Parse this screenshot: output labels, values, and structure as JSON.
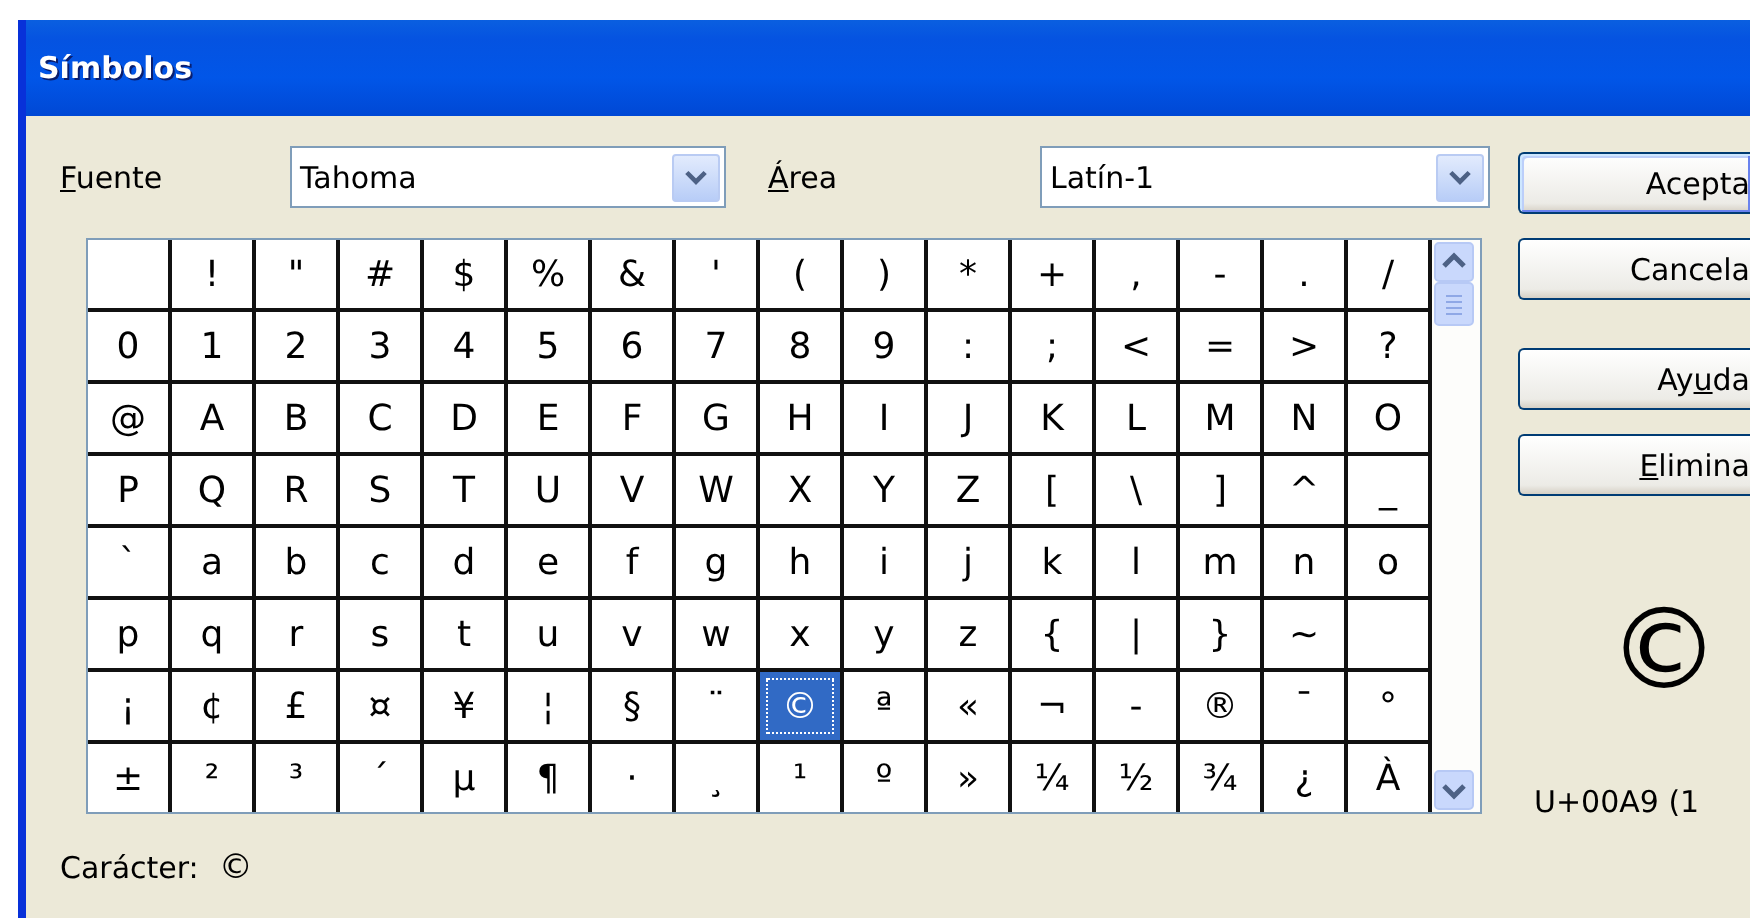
{
  "window": {
    "title": "Símbolos"
  },
  "font_field": {
    "label": [
      {
        "text": "F",
        "underlined": true
      },
      {
        "text": "uente",
        "underlined": false
      }
    ],
    "value": "Tahoma"
  },
  "area_field": {
    "label": [
      {
        "text": "Á",
        "underlined": true
      },
      {
        "text": "rea",
        "underlined": false
      }
    ],
    "value": "Latín-1"
  },
  "grid": {
    "rows": [
      {
        "cells": [
          {
            "selected": false
          },
          {
            "char": "!",
            "selected": false
          },
          {
            "char": "\"",
            "selected": false
          },
          {
            "char": "#",
            "selected": false
          },
          {
            "char": "$",
            "selected": false
          },
          {
            "char": "%",
            "selected": false
          },
          {
            "char": "&",
            "selected": false
          },
          {
            "char": "'",
            "selected": false
          },
          {
            "char": "(",
            "selected": false
          },
          {
            "char": ")",
            "selected": false
          },
          {
            "char": "*",
            "selected": false
          },
          {
            "char": "+",
            "selected": false
          },
          {
            "char": ",",
            "selected": false
          },
          {
            "char": "-",
            "selected": false
          },
          {
            "char": ".",
            "selected": false
          },
          {
            "char": "/",
            "selected": false
          }
        ]
      },
      {
        "cells": [
          {
            "char": "0",
            "selected": false
          },
          {
            "char": "1",
            "selected": false
          },
          {
            "char": "2",
            "selected": false
          },
          {
            "char": "3",
            "selected": false
          },
          {
            "char": "4",
            "selected": false
          },
          {
            "char": "5",
            "selected": false
          },
          {
            "char": "6",
            "selected": false
          },
          {
            "char": "7",
            "selected": false
          },
          {
            "char": "8",
            "selected": false
          },
          {
            "char": "9",
            "selected": false
          },
          {
            "char": ":",
            "selected": false
          },
          {
            "char": ";",
            "selected": false
          },
          {
            "char": "<",
            "selected": false
          },
          {
            "char": "=",
            "selected": false
          },
          {
            "char": ">",
            "selected": false
          },
          {
            "char": "?",
            "selected": false
          }
        ]
      },
      {
        "cells": [
          {
            "char": "@",
            "selected": false
          },
          {
            "char": "A",
            "selected": false
          },
          {
            "char": "B",
            "selected": false
          },
          {
            "char": "C",
            "selected": false
          },
          {
            "char": "D",
            "selected": false
          },
          {
            "char": "E",
            "selected": false
          },
          {
            "char": "F",
            "selected": false
          },
          {
            "char": "G",
            "selected": false
          },
          {
            "char": "H",
            "selected": false
          },
          {
            "char": "I",
            "selected": false
          },
          {
            "char": "J",
            "selected": false
          },
          {
            "char": "K",
            "selected": false
          },
          {
            "char": "L",
            "selected": false
          },
          {
            "char": "M",
            "selected": false
          },
          {
            "char": "N",
            "selected": false
          },
          {
            "char": "O",
            "selected": false
          }
        ]
      },
      {
        "cells": [
          {
            "char": "P",
            "selected": false
          },
          {
            "char": "Q",
            "selected": false
          },
          {
            "char": "R",
            "selected": false
          },
          {
            "char": "S",
            "selected": false
          },
          {
            "char": "T",
            "selected": false
          },
          {
            "char": "U",
            "selected": false
          },
          {
            "char": "V",
            "selected": false
          },
          {
            "char": "W",
            "selected": false
          },
          {
            "char": "X",
            "selected": false
          },
          {
            "char": "Y",
            "selected": false
          },
          {
            "char": "Z",
            "selected": false
          },
          {
            "char": "[",
            "selected": false
          },
          {
            "char": "\\",
            "selected": false
          },
          {
            "char": "]",
            "selected": false
          },
          {
            "char": "^",
            "selected": false
          },
          {
            "char": "_",
            "selected": false
          }
        ]
      },
      {
        "cells": [
          {
            "char": "`",
            "selected": false
          },
          {
            "char": "a",
            "selected": false
          },
          {
            "char": "b",
            "selected": false
          },
          {
            "char": "c",
            "selected": false
          },
          {
            "char": "d",
            "selected": false
          },
          {
            "char": "e",
            "selected": false
          },
          {
            "char": "f",
            "selected": false
          },
          {
            "char": "g",
            "selected": false
          },
          {
            "char": "h",
            "selected": false
          },
          {
            "char": "i",
            "selected": false
          },
          {
            "char": "j",
            "selected": false
          },
          {
            "char": "k",
            "selected": false
          },
          {
            "char": "l",
            "selected": false
          },
          {
            "char": "m",
            "selected": false
          },
          {
            "char": "n",
            "selected": false
          },
          {
            "char": "o",
            "selected": false
          }
        ]
      },
      {
        "cells": [
          {
            "char": "p",
            "selected": false
          },
          {
            "char": "q",
            "selected": false
          },
          {
            "char": "r",
            "selected": false
          },
          {
            "char": "s",
            "selected": false
          },
          {
            "char": "t",
            "selected": false
          },
          {
            "char": "u",
            "selected": false
          },
          {
            "char": "v",
            "selected": false
          },
          {
            "char": "w",
            "selected": false
          },
          {
            "char": "x",
            "selected": false
          },
          {
            "char": "y",
            "selected": false
          },
          {
            "char": "z",
            "selected": false
          },
          {
            "char": "{",
            "selected": false
          },
          {
            "char": "|",
            "selected": false
          },
          {
            "char": "}",
            "selected": false
          },
          {
            "char": "~",
            "selected": false
          },
          {
            "selected": false
          }
        ]
      },
      {
        "cells": [
          {
            "char": "¡",
            "selected": false
          },
          {
            "char": "¢",
            "selected": false
          },
          {
            "char": "£",
            "selected": false
          },
          {
            "char": "¤",
            "selected": false
          },
          {
            "char": "¥",
            "selected": false
          },
          {
            "char": "¦",
            "selected": false
          },
          {
            "char": "§",
            "selected": false
          },
          {
            "char": "¨",
            "selected": false
          },
          {
            "char": "©",
            "selected": true
          },
          {
            "char": "ª",
            "selected": false
          },
          {
            "char": "«",
            "selected": false
          },
          {
            "char": "¬",
            "selected": false
          },
          {
            "char": "-",
            "selected": false
          },
          {
            "char": "®",
            "selected": false
          },
          {
            "char": "¯",
            "selected": false
          },
          {
            "char": "°",
            "selected": false
          }
        ]
      },
      {
        "cells": [
          {
            "char": "±",
            "selected": false
          },
          {
            "char": "²",
            "selected": false
          },
          {
            "char": "³",
            "selected": false
          },
          {
            "char": "´",
            "selected": false
          },
          {
            "char": "µ",
            "selected": false
          },
          {
            "char": "¶",
            "selected": false
          },
          {
            "char": "·",
            "selected": false
          },
          {
            "char": "¸",
            "selected": false
          },
          {
            "char": "¹",
            "selected": false
          },
          {
            "char": "º",
            "selected": false
          },
          {
            "char": "»",
            "selected": false
          },
          {
            "char": "¼",
            "selected": false
          },
          {
            "char": "½",
            "selected": false
          },
          {
            "char": "¾",
            "selected": false
          },
          {
            "char": "¿",
            "selected": false
          },
          {
            "char": "À",
            "selected": false
          }
        ]
      }
    ]
  },
  "buttons": [
    {
      "label": [
        {
          "text": "Acepta",
          "underlined": false
        }
      ],
      "default": true
    },
    {
      "label": [
        {
          "text": "Cancela",
          "underlined": false
        }
      ],
      "default": false
    },
    {
      "label": [
        {
          "text": "Ay",
          "underlined": false
        },
        {
          "text": "u",
          "underlined": true
        },
        {
          "text": "da",
          "underlined": false
        }
      ],
      "default": false
    },
    {
      "label": [
        {
          "text": "E",
          "underlined": true
        },
        {
          "text": "limina",
          "underlined": false
        }
      ],
      "default": false
    }
  ],
  "preview": {
    "glyph": "©",
    "code": "U+00A9 (1"
  },
  "character": {
    "label": "Carácter:",
    "value": "©"
  }
}
